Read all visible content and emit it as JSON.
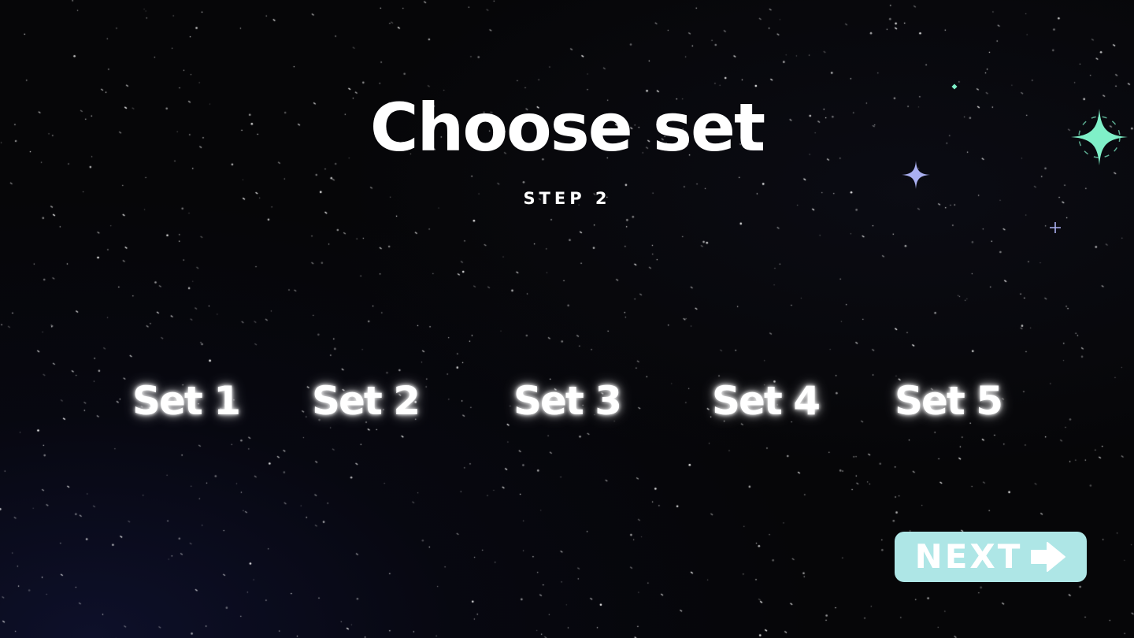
{
  "screen": {
    "title": "Choose set",
    "subtitle": "STEP 2"
  },
  "sets": [
    {
      "label": "Set 1"
    },
    {
      "label": "Set 2"
    },
    {
      "label": "Set 3"
    },
    {
      "label": "Set 4"
    },
    {
      "label": "Set 5"
    }
  ],
  "next_button": {
    "label": "NEXT",
    "icon": "arrow-right-icon"
  },
  "colors": {
    "background": "#060608",
    "text": "#ffffff",
    "next_button_bg": "#aee6e6",
    "sparkle_large": "#7ff0c8",
    "sparkle_small": "#aab0f0"
  }
}
